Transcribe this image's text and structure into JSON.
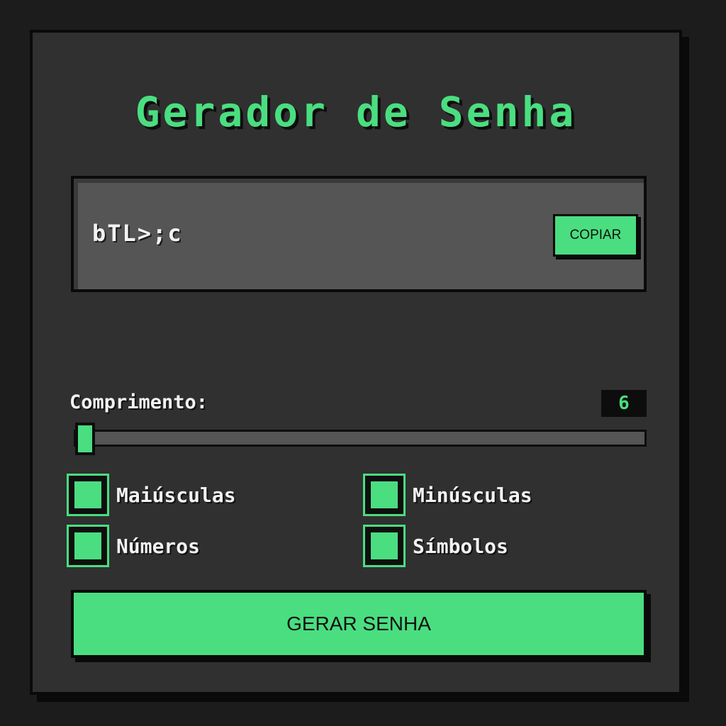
{
  "app": {
    "title": "Gerador de Senha"
  },
  "password": {
    "value": "bTL>;c",
    "copy_label": "COPIAR"
  },
  "length": {
    "label": "Comprimento:",
    "value": "6",
    "slider_fraction": 0.0
  },
  "options": [
    {
      "label": "Maiúsculas",
      "checked": true
    },
    {
      "label": "Minúsculas",
      "checked": true
    },
    {
      "label": "Números",
      "checked": true
    },
    {
      "label": "Símbolos",
      "checked": true
    }
  ],
  "generate": {
    "label": "GERAR SENHA"
  },
  "colors": {
    "accent": "#4ade80",
    "background": "#1c1c1c",
    "card": "#303030",
    "display": "#555555"
  }
}
